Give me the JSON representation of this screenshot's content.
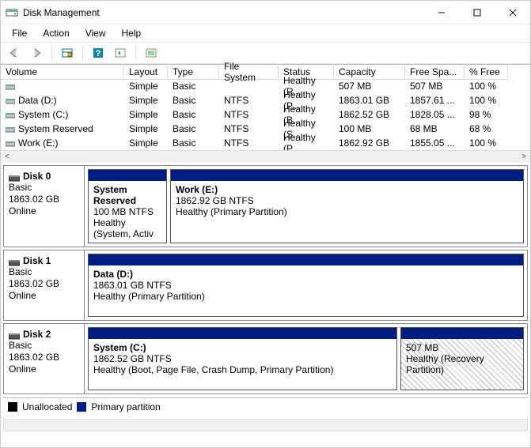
{
  "window": {
    "title": "Disk Management"
  },
  "menu": {
    "file": "File",
    "action": "Action",
    "view": "View",
    "help": "Help"
  },
  "columns": {
    "volume": "Volume",
    "layout": "Layout",
    "type": "Type",
    "fs": "File System",
    "status": "Status",
    "capacity": "Capacity",
    "free": "Free Spa...",
    "pct": "% Free"
  },
  "volumes": [
    {
      "name": "",
      "layout": "Simple",
      "type": "Basic",
      "fs": "",
      "status": "Healthy (R...",
      "cap": "507 MB",
      "free": "507 MB",
      "pct": "100 %"
    },
    {
      "name": "Data (D:)",
      "layout": "Simple",
      "type": "Basic",
      "fs": "NTFS",
      "status": "Healthy (P...",
      "cap": "1863.01 GB",
      "free": "1857.61 ...",
      "pct": "100 %"
    },
    {
      "name": "System (C:)",
      "layout": "Simple",
      "type": "Basic",
      "fs": "NTFS",
      "status": "Healthy (B...",
      "cap": "1862.52 GB",
      "free": "1828.05 ...",
      "pct": "98 %"
    },
    {
      "name": "System Reserved",
      "layout": "Simple",
      "type": "Basic",
      "fs": "NTFS",
      "status": "Healthy (S...",
      "cap": "100 MB",
      "free": "68 MB",
      "pct": "68 %"
    },
    {
      "name": "Work (E:)",
      "layout": "Simple",
      "type": "Basic",
      "fs": "NTFS",
      "status": "Healthy (P...",
      "cap": "1862.92 GB",
      "free": "1855.05 ...",
      "pct": "100 %"
    }
  ],
  "disks": [
    {
      "name": "Disk 0",
      "type": "Basic",
      "size": "1863.02 GB",
      "state": "Online",
      "parts": [
        {
          "title": "System Reserved",
          "line2": "100 MB NTFS",
          "line3": "Healthy (System, Activ",
          "flex": "0 0 100px",
          "hatched": false
        },
        {
          "title": "Work  (E:)",
          "line2": "1862.92 GB NTFS",
          "line3": "Healthy (Primary Partition)",
          "flex": "1",
          "hatched": false
        }
      ]
    },
    {
      "name": "Disk 1",
      "type": "Basic",
      "size": "1863.02 GB",
      "state": "Online",
      "parts": [
        {
          "title": "Data  (D:)",
          "line2": "1863.01 GB NTFS",
          "line3": "Healthy (Primary Partition)",
          "flex": "1",
          "hatched": false
        }
      ]
    },
    {
      "name": "Disk 2",
      "type": "Basic",
      "size": "1863.02 GB",
      "state": "Online",
      "parts": [
        {
          "title": "System  (C:)",
          "line2": "1862.52 GB NTFS",
          "line3": "Healthy (Boot, Page File, Crash Dump, Primary Partition)",
          "flex": "1",
          "hatched": false
        },
        {
          "title": "",
          "line2": "507 MB",
          "line3": "Healthy (Recovery Partition)",
          "flex": "0 0 156px",
          "hatched": true
        }
      ]
    }
  ],
  "legend": {
    "unalloc": "Unallocated",
    "primary": "Primary partition"
  }
}
